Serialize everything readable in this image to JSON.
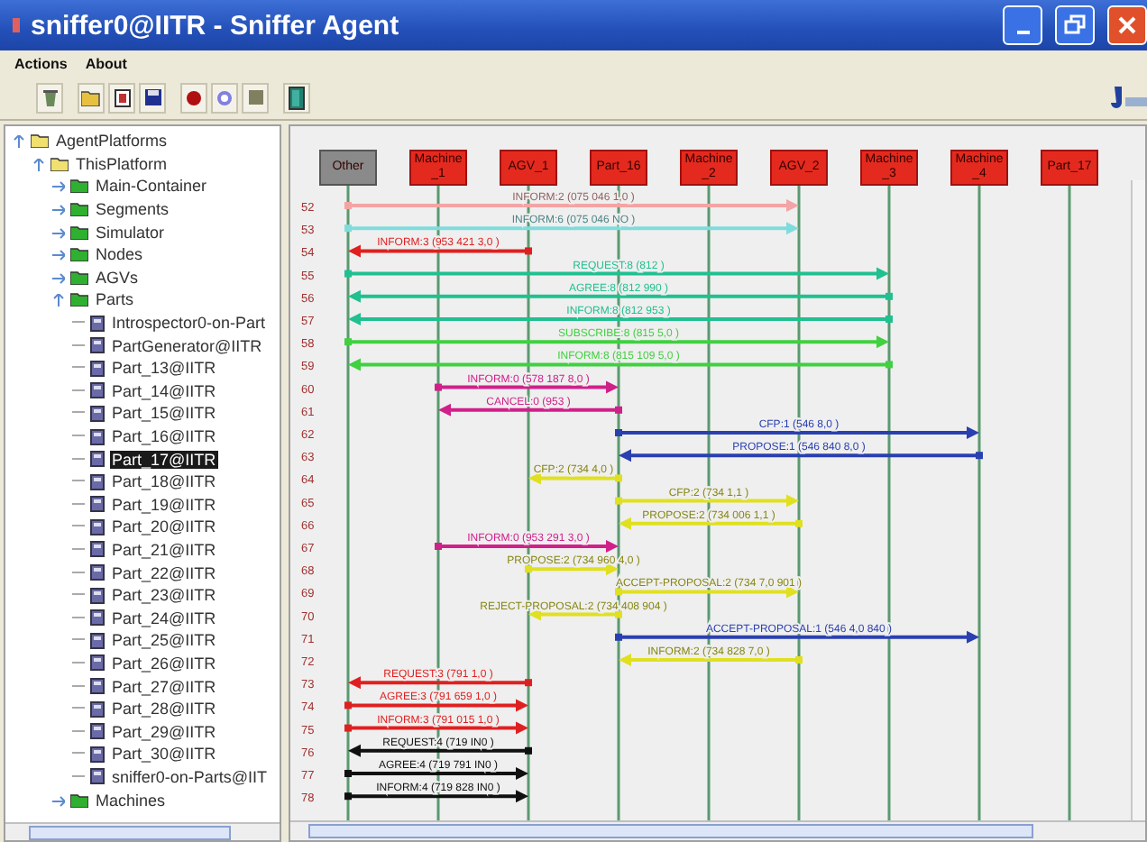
{
  "window": {
    "title": "sniffer0@IITR - Sniffer Agent"
  },
  "menu": [
    "Actions",
    "About"
  ],
  "tree": [
    {
      "label": "AgentPlatforms",
      "kind": "platform",
      "expanded": true,
      "selected": false,
      "children": [
        {
          "label": "ThisPlatform",
          "kind": "platform",
          "expanded": true,
          "selected": false,
          "children": [
            {
              "label": "Main-Container",
              "kind": "container",
              "expanded": false,
              "selected": false
            },
            {
              "label": "Segments",
              "kind": "container",
              "expanded": false,
              "selected": false
            },
            {
              "label": "Simulator",
              "kind": "container",
              "expanded": false,
              "selected": false
            },
            {
              "label": "Nodes",
              "kind": "container",
              "expanded": false,
              "selected": false
            },
            {
              "label": "AGVs",
              "kind": "container",
              "expanded": false,
              "selected": false
            },
            {
              "label": "Parts",
              "kind": "container",
              "expanded": true,
              "selected": false,
              "children": [
                {
                  "label": "Introspector0-on-Part",
                  "kind": "agent",
                  "selected": false
                },
                {
                  "label": "PartGenerator@IITR",
                  "kind": "agent",
                  "selected": false
                },
                {
                  "label": "Part_13@IITR",
                  "kind": "agent",
                  "selected": false
                },
                {
                  "label": "Part_14@IITR",
                  "kind": "agent",
                  "selected": false
                },
                {
                  "label": "Part_15@IITR",
                  "kind": "agent",
                  "selected": false
                },
                {
                  "label": "Part_16@IITR",
                  "kind": "agent",
                  "selected": false
                },
                {
                  "label": "Part_17@IITR",
                  "kind": "agent",
                  "selected": true
                },
                {
                  "label": "Part_18@IITR",
                  "kind": "agent",
                  "selected": false
                },
                {
                  "label": "Part_19@IITR",
                  "kind": "agent",
                  "selected": false
                },
                {
                  "label": "Part_20@IITR",
                  "kind": "agent",
                  "selected": false
                },
                {
                  "label": "Part_21@IITR",
                  "kind": "agent",
                  "selected": false
                },
                {
                  "label": "Part_22@IITR",
                  "kind": "agent",
                  "selected": false
                },
                {
                  "label": "Part_23@IITR",
                  "kind": "agent",
                  "selected": false
                },
                {
                  "label": "Part_24@IITR",
                  "kind": "agent",
                  "selected": false
                },
                {
                  "label": "Part_25@IITR",
                  "kind": "agent",
                  "selected": false
                },
                {
                  "label": "Part_26@IITR",
                  "kind": "agent",
                  "selected": false
                },
                {
                  "label": "Part_27@IITR",
                  "kind": "agent",
                  "selected": false
                },
                {
                  "label": "Part_28@IITR",
                  "kind": "agent",
                  "selected": false
                },
                {
                  "label": "Part_29@IITR",
                  "kind": "agent",
                  "selected": false
                },
                {
                  "label": "Part_30@IITR",
                  "kind": "agent",
                  "selected": false
                },
                {
                  "label": "sniffer0-on-Parts@IIT",
                  "kind": "agent",
                  "selected": false
                }
              ]
            },
            {
              "label": "Machines",
              "kind": "container",
              "expanded": false,
              "selected": false
            }
          ]
        }
      ]
    }
  ],
  "participants": [
    {
      "name": "Other",
      "kind": "other"
    },
    {
      "name": "Machine_1",
      "kind": "agent"
    },
    {
      "name": "AGV_1",
      "kind": "agent"
    },
    {
      "name": "Part_16",
      "kind": "agent"
    },
    {
      "name": "Machine_2",
      "kind": "agent"
    },
    {
      "name": "AGV_2",
      "kind": "agent"
    },
    {
      "name": "Machine_3",
      "kind": "agent"
    },
    {
      "name": "Machine_4",
      "kind": "agent"
    },
    {
      "name": "Part_17",
      "kind": "agent"
    }
  ],
  "messages": [
    {
      "number": "52",
      "label": "INFORM:2 (075 046 1,0 )",
      "color": "#f4a4a4"
    },
    {
      "number": "53",
      "label": "INFORM:6 (075 046 NO )",
      "color": "#80dcdc"
    },
    {
      "number": "54",
      "label": "INFORM:3 (953 421 3,0 )",
      "color": "#e02020"
    },
    {
      "number": "55",
      "label": "REQUEST:8 (812 )",
      "color": "#20c090"
    },
    {
      "number": "56",
      "label": "AGREE:8 (812 990 )",
      "color": "#20c090"
    },
    {
      "number": "57",
      "label": "INFORM:8 (812 953 )",
      "color": "#20c090"
    },
    {
      "number": "58",
      "label": "SUBSCRIBE:8 (815 5,0 )",
      "color": "#40d040"
    },
    {
      "number": "59",
      "label": "INFORM:8 (815 109 5,0 )",
      "color": "#40d040"
    },
    {
      "number": "60",
      "label": "INFORM:0 (578 187 8,0 )",
      "color": "#d0208a"
    },
    {
      "number": "61",
      "label": "CANCEL:0 (953 )",
      "color": "#d0208a"
    },
    {
      "number": "62",
      "label": "CFP:1 (546 8,0 )",
      "color": "#2a40b0"
    },
    {
      "number": "63",
      "label": "PROPOSE:1 (546 840 8,0 )",
      "color": "#2a40b0"
    },
    {
      "number": "64",
      "label": "CFP:2 (734 4,0 )",
      "color": "#e0e020"
    },
    {
      "number": "65",
      "label": "CFP:2 (734 1,1 )",
      "color": "#e0e020"
    },
    {
      "number": "66",
      "label": "PROPOSE:2 (734 006 1,1 )",
      "color": "#e0e020"
    },
    {
      "number": "67",
      "label": "INFORM:0 (953 291 3,0 )",
      "color": "#d0208a"
    },
    {
      "number": "68",
      "label": "PROPOSE:2 (734 960 4,0 )",
      "color": "#e0e020"
    },
    {
      "number": "69",
      "label": "ACCEPT-PROPOSAL:2 (734 7,0 901 )",
      "color": "#e0e020"
    },
    {
      "number": "70",
      "label": "REJECT-PROPOSAL:2 (734 408 904 )",
      "color": "#e0e020"
    },
    {
      "number": "71",
      "label": "ACCEPT-PROPOSAL:1 (546 4,0 840 )",
      "color": "#2a40b0"
    },
    {
      "number": "72",
      "label": "INFORM:2 (734 828 7,0 )",
      "color": "#e0e020"
    },
    {
      "number": "73",
      "label": "REQUEST:3 (791 1,0 )",
      "color": "#e02020"
    },
    {
      "number": "74",
      "label": "AGREE:3 (791 659 1,0 )",
      "color": "#e02020"
    },
    {
      "number": "75",
      "label": "INFORM:3 (791 015 1,0 )",
      "color": "#e02020"
    },
    {
      "number": "76",
      "label": "REQUEST:4 (719 IN0 )",
      "color": "#101010"
    },
    {
      "number": "77",
      "label": "AGREE:4 (719 791 IN0 )",
      "color": "#101010"
    },
    {
      "number": "78",
      "label": "INFORM:4 (719 828 IN0 )",
      "color": "#101010"
    }
  ]
}
